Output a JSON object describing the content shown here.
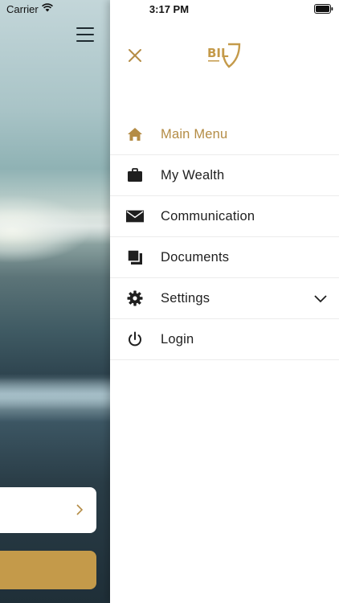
{
  "status_bar": {
    "carrier": "Carrier",
    "time": "3:17 PM"
  },
  "colors": {
    "accent_gold": "#b48c45",
    "button_gold": "#c49a4a",
    "text_dark": "#1f1f1f",
    "divider": "#ececec"
  },
  "drawer": {
    "logo_icon": "bil-logo-icon",
    "close_icon": "close-icon",
    "items": [
      {
        "label": "Main Menu",
        "icon": "home-icon",
        "active": true
      },
      {
        "label": "My Wealth",
        "icon": "briefcase-icon",
        "active": false
      },
      {
        "label": "Communication",
        "icon": "envelope-icon",
        "active": false
      },
      {
        "label": "Documents",
        "icon": "documents-icon",
        "active": false
      },
      {
        "label": "Settings",
        "icon": "gear-icon",
        "active": false,
        "expandable": true
      },
      {
        "label": "Login",
        "icon": "power-icon",
        "active": false
      }
    ]
  }
}
